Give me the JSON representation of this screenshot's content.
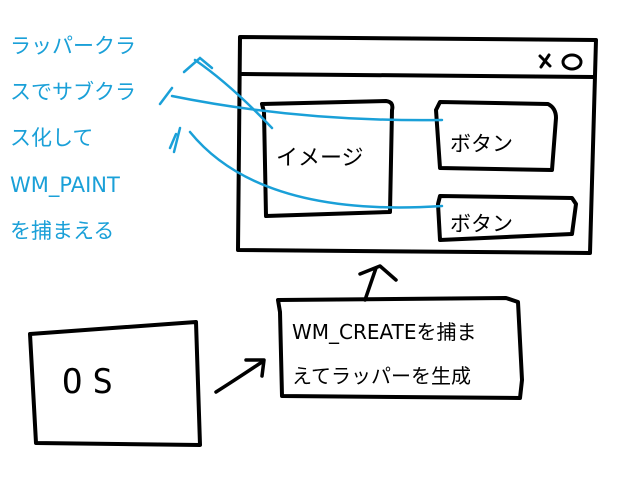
{
  "colors": {
    "ink": "#000000",
    "annotation": "#1aa0d8",
    "background": "#ffffff"
  },
  "annotation": {
    "lines": [
      "ラッパークラ",
      "スでサブクラ",
      "ス化して",
      "WM_PAINT",
      "を捕まえる"
    ]
  },
  "window": {
    "close_glyph": "×o",
    "image_label": "イメージ",
    "button1_label": "ボタン",
    "button2_label": "ボタン"
  },
  "os_box": {
    "label": "OS"
  },
  "process_box": {
    "line1": "WM_CREATEを捕ま",
    "line2": "えてラッパーを生成"
  },
  "icons": {
    "close": "close-icon",
    "arrow_os_to_process": "arrow-right-icon",
    "arrow_process_to_window": "arrow-up-icon"
  }
}
